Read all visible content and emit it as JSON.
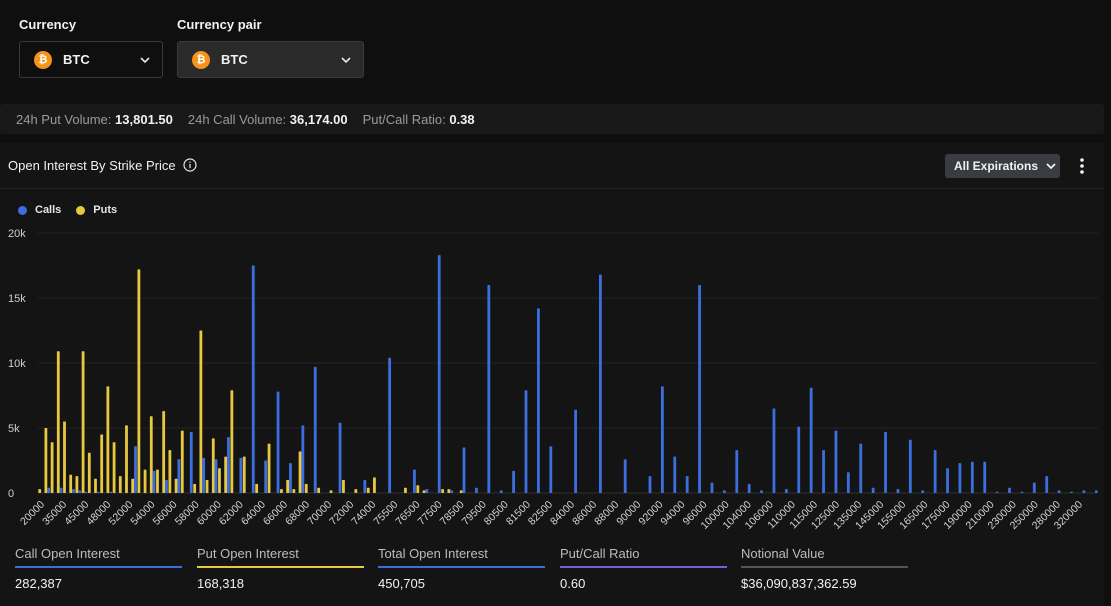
{
  "header": {
    "currency_label": "Currency",
    "currency_value": "BTC",
    "pair_label": "Currency pair",
    "pair_value": "BTC",
    "coin_glyph": "₿"
  },
  "stats": {
    "put_volume_label": "24h Put Volume:",
    "put_volume_value": "13,801.50",
    "call_volume_label": "24h Call Volume:",
    "call_volume_value": "36,174.00",
    "ratio_label": "Put/Call Ratio:",
    "ratio_value": "0.38"
  },
  "panel": {
    "title": "Open Interest By Strike Price",
    "expirations_label": "All Expirations"
  },
  "legend": {
    "calls": "Calls",
    "puts": "Puts"
  },
  "colors": {
    "calls": "#3b6fe0",
    "puts": "#e8c83f",
    "total": "#3b6fe0",
    "ratio": "#7b5cd6",
    "notional": "#555555"
  },
  "chart_data": {
    "type": "bar",
    "ylim": [
      0,
      20000
    ],
    "yticks": [
      "0",
      "5k",
      "10k",
      "15k",
      "20k"
    ],
    "grid": true,
    "legend_position": "top-left",
    "categories": [
      "20000",
      "35000",
      "45000",
      "48000",
      "52000",
      "54000",
      "56000",
      "58000",
      "60000",
      "62000",
      "64000",
      "66000",
      "68000",
      "70000",
      "72000",
      "74000",
      "75500",
      "76500",
      "77500",
      "78500",
      "79500",
      "80500",
      "81500",
      "82500",
      "84000",
      "86000",
      "88000",
      "90000",
      "92000",
      "94000",
      "96000",
      "100000",
      "104000",
      "106000",
      "110000",
      "115000",
      "125000",
      "135000",
      "145000",
      "155000",
      "165000",
      "175000",
      "190000",
      "210000",
      "230000",
      "250000",
      "280000",
      "320000"
    ],
    "series": [
      {
        "name": "Calls",
        "values": [
          0,
          400,
          0,
          400,
          0,
          300,
          200,
          100,
          0,
          100,
          0,
          100,
          0,
          0,
          0,
          3600,
          0,
          0,
          1700,
          0,
          1000,
          0,
          2600,
          0,
          4700,
          0,
          2700,
          0,
          2600,
          0,
          4300,
          0,
          2700,
          0,
          17500,
          0,
          2500,
          0,
          7800,
          0,
          2300,
          0,
          5200,
          0,
          9700,
          0,
          0,
          0,
          5400,
          0,
          0,
          0,
          1000,
          0,
          0,
          0,
          10400,
          0,
          0,
          0,
          1800,
          0,
          300,
          0,
          18300,
          0,
          200,
          0,
          3500,
          0,
          400,
          0,
          16000,
          0,
          200,
          0,
          1700,
          0,
          7900,
          0,
          14200,
          0,
          3600,
          0,
          0,
          0,
          6400,
          0,
          0,
          0,
          16800,
          0,
          0,
          0,
          2600,
          0,
          0,
          0,
          1300,
          0,
          8200,
          0,
          2800,
          0,
          1300,
          0,
          16000,
          0,
          800,
          0,
          200,
          0,
          3300,
          0,
          700,
          0,
          200,
          0,
          6500,
          0,
          300,
          0,
          5100,
          0,
          8100,
          0,
          3300,
          0,
          4800,
          0,
          1600,
          0,
          3800,
          0,
          400,
          0,
          4700,
          0,
          300,
          0,
          4100,
          0,
          200,
          0,
          3300,
          0,
          1900,
          0,
          2300,
          0,
          2400,
          0,
          2400,
          0,
          100,
          0,
          400,
          0,
          100,
          0,
          800,
          0,
          1300,
          0,
          200,
          0,
          100,
          0,
          200,
          0,
          200
        ]
      },
      {
        "name": "Puts",
        "values": [
          300,
          5000,
          3900,
          10900,
          5500,
          1400,
          1300,
          10900,
          3100,
          1100,
          4500,
          8200,
          3900,
          1300,
          5200,
          1100,
          17200,
          1800,
          5900,
          1800,
          6300,
          3300,
          1100,
          4800,
          0,
          700,
          12500,
          1000,
          4200,
          1900,
          2800,
          7900,
          0,
          2800,
          0,
          700,
          0,
          3800,
          0,
          300,
          1000,
          300,
          3200,
          700,
          0,
          400,
          0,
          200,
          0,
          1000,
          0,
          300,
          0,
          400,
          1200,
          0,
          0,
          0,
          0,
          400,
          0,
          600,
          200,
          0,
          0,
          300,
          300,
          0,
          200,
          0,
          0,
          0,
          0,
          0,
          0,
          0,
          0,
          0,
          0,
          0,
          0,
          0,
          0,
          0,
          0,
          0,
          0,
          0,
          0,
          0,
          0,
          0,
          0,
          0,
          0,
          0,
          0,
          0,
          0,
          0,
          0,
          0,
          0,
          0,
          0,
          0,
          0,
          0,
          0,
          0,
          0,
          0,
          0,
          0,
          0,
          0,
          0,
          0,
          0,
          0,
          0,
          0,
          0,
          0,
          0,
          0,
          0,
          0,
          0,
          0,
          0,
          0,
          0,
          0,
          0,
          0,
          0,
          0,
          0,
          0,
          0,
          0,
          0,
          0,
          0,
          0,
          0,
          0,
          0,
          0,
          0,
          0,
          0,
          0,
          0,
          0,
          0,
          0,
          0,
          0,
          0,
          0,
          0,
          0,
          0,
          0,
          0,
          0,
          0,
          0,
          0,
          0,
          0,
          0
        ]
      }
    ]
  },
  "metrics": [
    {
      "label": "Call Open Interest",
      "value": "282,387",
      "color": "#3b6fe0"
    },
    {
      "label": "Put Open Interest",
      "value": "168,318",
      "color": "#e8c83f"
    },
    {
      "label": "Total Open Interest",
      "value": "450,705",
      "color": "#3b6fe0"
    },
    {
      "label": "Put/Call Ratio",
      "value": "0.60",
      "color": "#7b5cd6"
    },
    {
      "label": "Notional Value",
      "value": "$36,090,837,362.59",
      "color": "#555555"
    }
  ]
}
